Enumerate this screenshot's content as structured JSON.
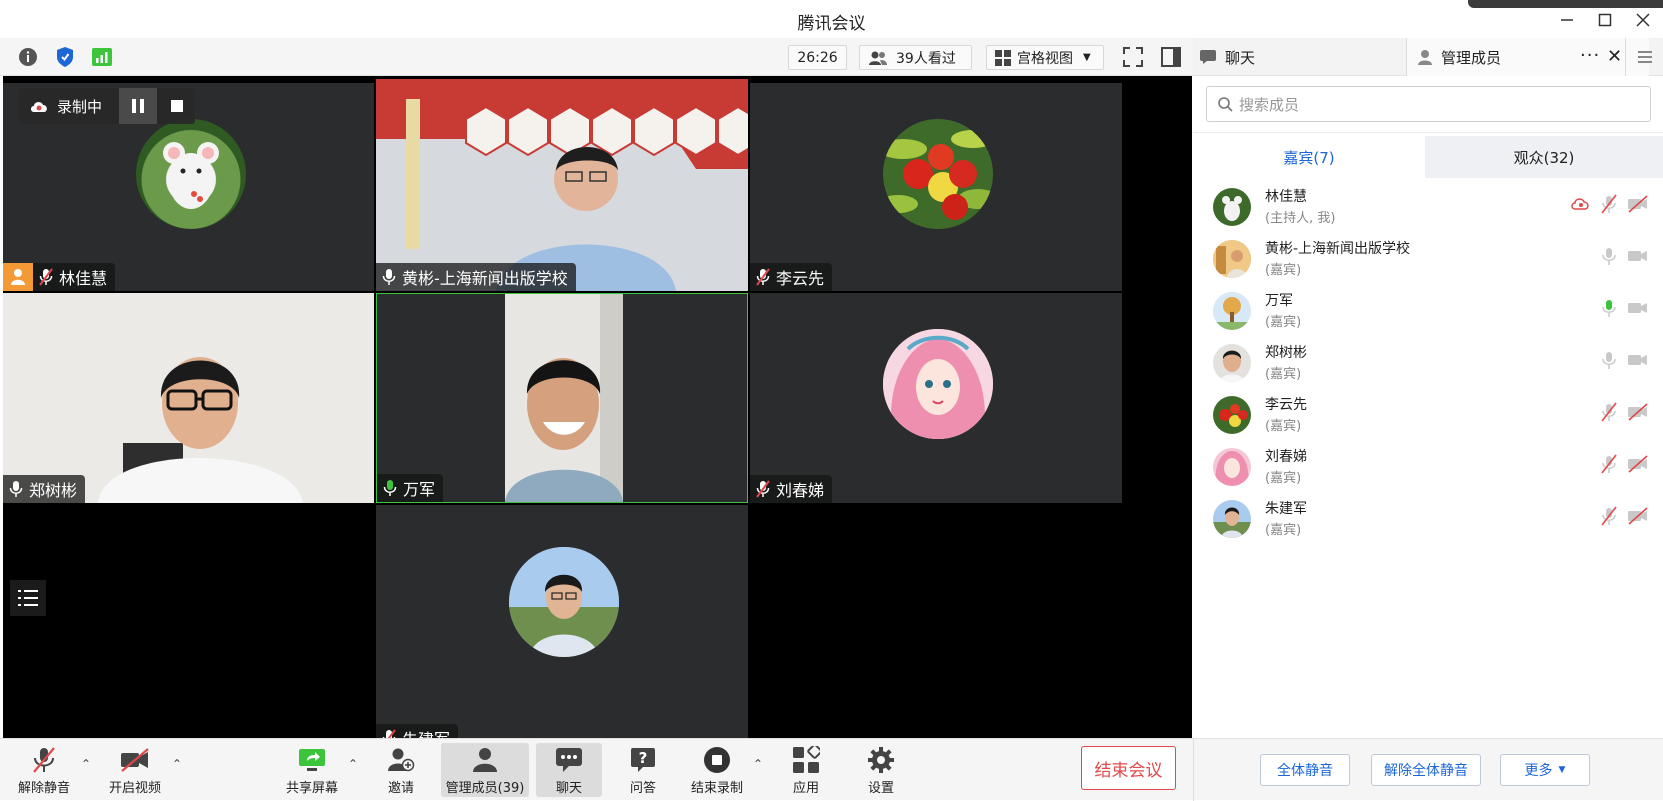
{
  "window": {
    "title": "腾讯会议"
  },
  "toolbar": {
    "timer": "26:26",
    "viewers": "39人看过",
    "view_mode": "宫格视图"
  },
  "right_header": {
    "chat_tab": "聊天",
    "members_tab": "管理成员"
  },
  "recording": {
    "label": "录制中"
  },
  "tiles": [
    {
      "name": "林佳慧",
      "mic": "muted",
      "host": true
    },
    {
      "name": "黄彬-上海新闻出版学校",
      "mic": "on"
    },
    {
      "name": "李云先",
      "mic": "muted"
    },
    {
      "name": "郑树彬",
      "mic": "on"
    },
    {
      "name": "万军",
      "mic": "speaking"
    },
    {
      "name": "刘春娣",
      "mic": "muted"
    },
    {
      "name": "朱建军",
      "mic": "muted"
    }
  ],
  "members_panel": {
    "search_placeholder": "搜索成员",
    "guests_tab": "嘉宾(7)",
    "audience_tab": "观众(32)",
    "members": [
      {
        "name": "林佳慧",
        "role": "(主持人, 我)",
        "recording": true,
        "mic": "muted",
        "cam": "off"
      },
      {
        "name": "黄彬-上海新闻出版学校",
        "role": "(嘉宾)",
        "mic": "on",
        "cam": "on"
      },
      {
        "name": "万军",
        "role": "(嘉宾)",
        "mic": "speaking",
        "cam": "on"
      },
      {
        "name": "郑树彬",
        "role": "(嘉宾)",
        "mic": "on",
        "cam": "on"
      },
      {
        "name": "李云先",
        "role": "(嘉宾)",
        "mic": "muted",
        "cam": "off"
      },
      {
        "name": "刘春娣",
        "role": "(嘉宾)",
        "mic": "muted",
        "cam": "off"
      },
      {
        "name": "朱建军",
        "role": "(嘉宾)",
        "mic": "muted",
        "cam": "off"
      }
    ],
    "mute_all": "全体静音",
    "unmute_all": "解除全体静音",
    "more": "更多"
  },
  "bottom": {
    "unmute": "解除静音",
    "start_video": "开启视频",
    "share_screen": "共享屏幕",
    "invite": "邀请",
    "manage_members": "管理成员(39)",
    "chat": "聊天",
    "qa": "问答",
    "stop_recording": "结束录制",
    "apps": "应用",
    "settings": "设置",
    "end_meeting": "结束会议"
  },
  "colors": {
    "accent_blue": "#1c66d6",
    "speaking_green": "#3cc43c",
    "muted_red": "#e0484b",
    "host_orange": "#f39a36"
  }
}
